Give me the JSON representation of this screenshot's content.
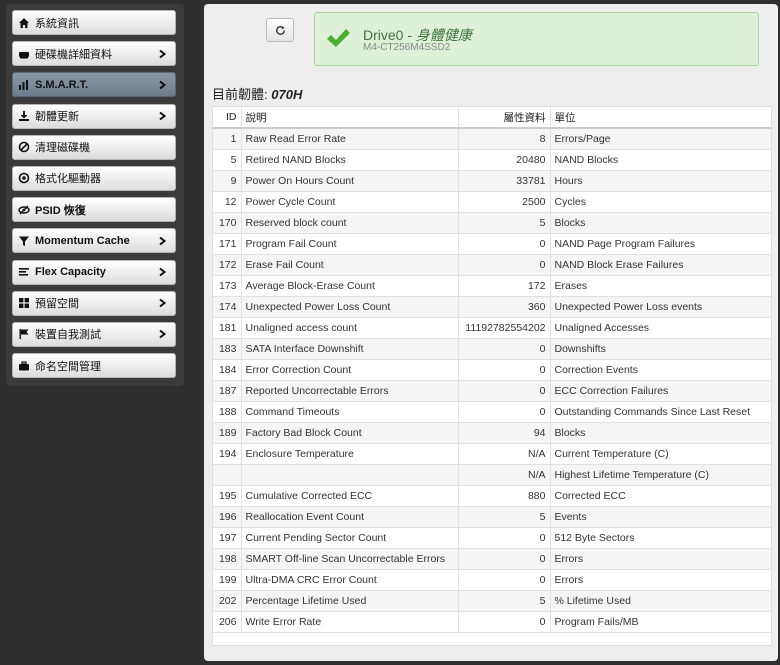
{
  "sidebar": {
    "items": [
      {
        "label": "系統資訊",
        "icon": "home-icon",
        "chevron": false,
        "active": false
      },
      {
        "label": "硬碟機詳細資料",
        "icon": "drive-icon",
        "chevron": true,
        "active": false
      },
      {
        "label": "S.M.A.R.T.",
        "icon": "bar-chart-icon",
        "chevron": true,
        "active": true
      },
      {
        "label": "韌體更新",
        "icon": "download-icon",
        "chevron": true,
        "active": false
      },
      {
        "label": "清理磁碟機",
        "icon": "ban-icon",
        "chevron": false,
        "active": false
      },
      {
        "label": "格式化驅動器",
        "icon": "target-icon",
        "chevron": false,
        "active": false
      },
      {
        "label": "PSID 恢復",
        "icon": "eye-slash-icon",
        "chevron": false,
        "active": false
      },
      {
        "label": "Momentum Cache",
        "icon": "filter-icon",
        "chevron": true,
        "active": false
      },
      {
        "label": "Flex Capacity",
        "icon": "align-left-icon",
        "chevron": true,
        "active": false
      },
      {
        "label": "預留空間",
        "icon": "grid-icon",
        "chevron": true,
        "active": false
      },
      {
        "label": "裝置自我測試",
        "icon": "flag-icon",
        "chevron": true,
        "active": false
      },
      {
        "label": "命名空間管理",
        "icon": "briefcase-icon",
        "chevron": false,
        "active": false
      }
    ]
  },
  "header": {
    "drive_prefix": "Drive0 - ",
    "health": "身體健康",
    "model": "M4-CT256M4SSD2",
    "firmware_label": "目前韌體:",
    "firmware_value": "070H"
  },
  "table": {
    "columns": [
      "ID",
      "說明",
      "屬性資料",
      "單位"
    ],
    "rows": [
      [
        "1",
        "Raw Read Error Rate",
        "8",
        "Errors/Page"
      ],
      [
        "5",
        "Retired NAND Blocks",
        "20480",
        "NAND Blocks"
      ],
      [
        "9",
        "Power On Hours Count",
        "33781",
        "Hours"
      ],
      [
        "12",
        "Power Cycle Count",
        "2500",
        "Cycles"
      ],
      [
        "170",
        "Reserved block count",
        "5",
        "Blocks"
      ],
      [
        "171",
        "Program Fail Count",
        "0",
        "NAND Page Program Failures"
      ],
      [
        "172",
        "Erase Fail Count",
        "0",
        "NAND Block Erase Failures"
      ],
      [
        "173",
        "Average Block-Erase Count",
        "172",
        "Erases"
      ],
      [
        "174",
        "Unexpected Power Loss Count",
        "360",
        "Unexpected Power Loss events"
      ],
      [
        "181",
        "Unaligned access count",
        "11192782554202",
        "Unaligned Accesses"
      ],
      [
        "183",
        "SATA Interface Downshift",
        "0",
        "Downshifts"
      ],
      [
        "184",
        "Error Correction Count",
        "0",
        "Correction Events"
      ],
      [
        "187",
        "Reported Uncorrectable Errors",
        "0",
        "ECC Correction Failures"
      ],
      [
        "188",
        "Command Timeouts",
        "0",
        "Outstanding Commands Since Last Reset"
      ],
      [
        "189",
        "Factory Bad Block Count",
        "94",
        "Blocks"
      ],
      [
        "194",
        "Enclosure Temperature",
        "N/A",
        "Current Temperature (C)"
      ],
      [
        "",
        "",
        "N/A",
        "Highest Lifetime Temperature (C)"
      ],
      [
        "195",
        "Cumulative Corrected ECC",
        "880",
        "Corrected ECC"
      ],
      [
        "196",
        "Reallocation Event Count",
        "5",
        "Events"
      ],
      [
        "197",
        "Current Pending Sector Count",
        "0",
        "512 Byte Sectors"
      ],
      [
        "198",
        "SMART Off-line Scan Uncorrectable Errors",
        "0",
        "Errors"
      ],
      [
        "199",
        "Ultra-DMA CRC Error Count",
        "0",
        "Errors"
      ],
      [
        "202",
        "Percentage Lifetime Used",
        "5",
        "% Lifetime Used"
      ],
      [
        "206",
        "Write Error Rate",
        "0",
        "Program Fails/MB"
      ]
    ]
  },
  "colors": {
    "success_bg": "#dff0d8",
    "success_text": "#3c763d",
    "check_green": "#4cae2e",
    "active_nav": "#7b8898"
  }
}
